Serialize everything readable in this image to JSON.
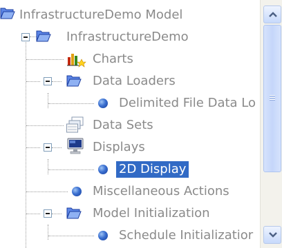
{
  "tree": {
    "items": [
      {
        "label": "InfrastructureDemo Model",
        "icon": "folder-open-icon"
      },
      {
        "label": "InfrastructureDemo",
        "icon": "folder-open-icon"
      },
      {
        "label": "Charts",
        "icon": "chart-icon"
      },
      {
        "label": "Data Loaders",
        "icon": "folder-open-icon"
      },
      {
        "label": "Delimited File Data Lo",
        "icon": "blue-dot-icon"
      },
      {
        "label": "Data Sets",
        "icon": "data-sets-icon"
      },
      {
        "label": "Displays",
        "icon": "display-monitor-icon"
      },
      {
        "label": "2D Display",
        "icon": "blue-dot-icon",
        "selected": true
      },
      {
        "label": "Miscellaneous Actions",
        "icon": "blue-dot-icon"
      },
      {
        "label": "Model Initialization",
        "icon": "folder-open-icon"
      },
      {
        "label": "Schedule Initializatior",
        "icon": "blue-dot-icon"
      }
    ]
  },
  "colors": {
    "selection": "#316ac5",
    "label": "#8a8a8a",
    "dot": "#3a6fd0"
  }
}
